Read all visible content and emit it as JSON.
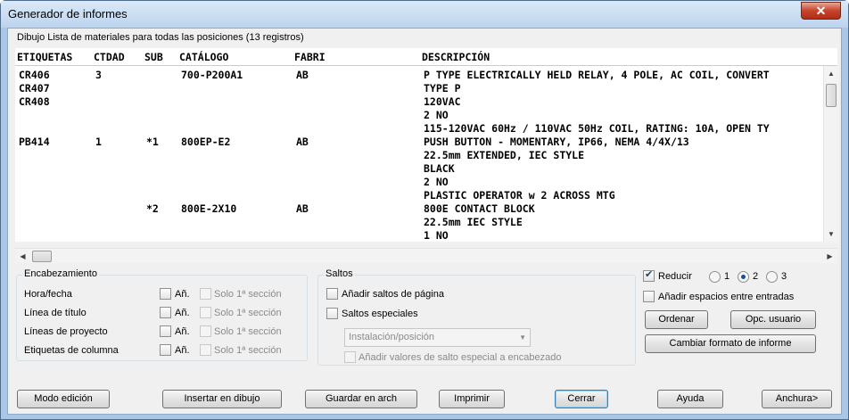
{
  "window": {
    "title": "Generador de informes",
    "close_glyph": "✕"
  },
  "report": {
    "subtitle": "Dibujo Lista de materiales para todas las posiciones (13 registros)",
    "columns": [
      "ETIQUETAS",
      "CTDAD",
      "SUB",
      "CATÁLOGO",
      "FABRI",
      "DESCRIPCIÓN"
    ],
    "rows": [
      {
        "tag": "CR406",
        "qty": "3",
        "sub": "",
        "cat": "700-P200A1",
        "mfg": "AB",
        "desc": "P TYPE ELECTRICALLY HELD RELAY, 4 POLE, AC COIL, CONVERT"
      },
      {
        "tag": "CR407",
        "qty": "",
        "sub": "",
        "cat": "",
        "mfg": "",
        "desc": "TYPE P"
      },
      {
        "tag": "CR408",
        "qty": "",
        "sub": "",
        "cat": "",
        "mfg": "",
        "desc": "120VAC"
      },
      {
        "tag": "",
        "qty": "",
        "sub": "",
        "cat": "",
        "mfg": "",
        "desc": "2 NO"
      },
      {
        "tag": "",
        "qty": "",
        "sub": "",
        "cat": "",
        "mfg": "",
        "desc": "115-120VAC 60Hz / 110VAC 50Hz COIL, RATING: 10A, OPEN TY"
      },
      {
        "tag": "PB414",
        "qty": "1",
        "sub": "*1",
        "cat": "800EP-E2",
        "mfg": "AB",
        "desc": "PUSH BUTTON - MOMENTARY, IP66, NEMA 4/4X/13"
      },
      {
        "tag": "",
        "qty": "",
        "sub": "",
        "cat": "",
        "mfg": "",
        "desc": "22.5mm EXTENDED, IEC STYLE"
      },
      {
        "tag": "",
        "qty": "",
        "sub": "",
        "cat": "",
        "mfg": "",
        "desc": "BLACK"
      },
      {
        "tag": "",
        "qty": "",
        "sub": "",
        "cat": "",
        "mfg": "",
        "desc": "2 NO"
      },
      {
        "tag": "",
        "qty": "",
        "sub": "",
        "cat": "",
        "mfg": "",
        "desc": "PLASTIC OPERATOR w 2 ACROSS MTG"
      },
      {
        "tag": "",
        "qty": "",
        "sub": "*2",
        "cat": "800E-2X10",
        "mfg": "AB",
        "desc": "800E CONTACT BLOCK"
      },
      {
        "tag": "",
        "qty": "",
        "sub": "",
        "cat": "",
        "mfg": "",
        "desc": "22.5mm IEC STYLE"
      },
      {
        "tag": "",
        "qty": "",
        "sub": "",
        "cat": "",
        "mfg": "",
        "desc": "1 NO"
      }
    ]
  },
  "encabezamiento": {
    "title": "Encabezamiento",
    "rows": [
      {
        "label": "Hora/fecha",
        "add": "Añ.",
        "solo": "Solo 1ª sección"
      },
      {
        "label": "Línea de título",
        "add": "Añ.",
        "solo": "Solo 1ª sección"
      },
      {
        "label": "Líneas de proyecto",
        "add": "Añ.",
        "solo": "Solo 1ª sección"
      },
      {
        "label": "Etiquetas de columna",
        "add": "Añ.",
        "solo": "Solo 1ª sección"
      }
    ]
  },
  "saltos": {
    "title": "Saltos",
    "page_breaks": "Añadir saltos de página",
    "special": "Saltos especiales",
    "combo_value": "Instalación/posición",
    "add_values": "Añadir valores de salto especial a encabezado"
  },
  "options": {
    "reduce": "Reducir",
    "radio_options": [
      "1",
      "2",
      "3"
    ],
    "selected_radio": "2",
    "spaces": "Añadir espacios entre entradas",
    "sort": "Ordenar",
    "user_opts": "Opc. usuario",
    "change_format": "Cambiar formato de informe"
  },
  "buttons": {
    "edit_mode": "Modo edición",
    "insert": "Insertar en dibujo",
    "save": "Guardar en arch",
    "print": "Imprimir",
    "close": "Cerrar",
    "help": "Ayuda",
    "wider": "Anchura>"
  },
  "scroll_glyphs": {
    "up": "▲",
    "down": "▼",
    "left": "◀",
    "right": "▶",
    "combo": "▼"
  }
}
